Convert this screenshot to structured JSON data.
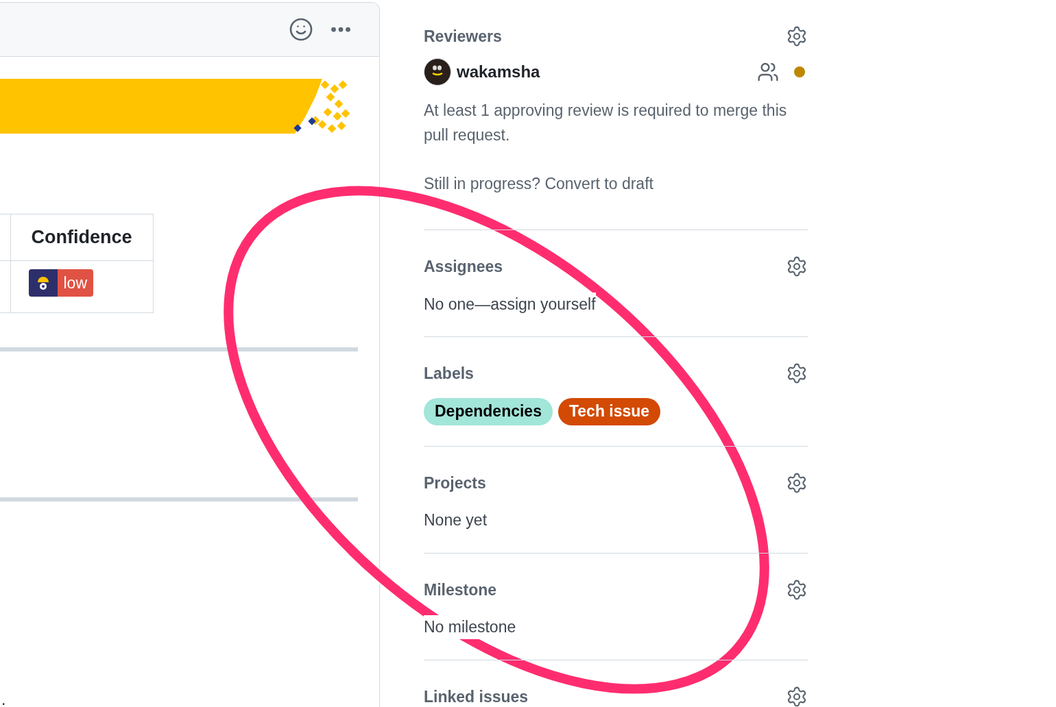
{
  "table": {
    "columns": [
      "Confidence"
    ],
    "rows": [
      {
        "confidence": "low"
      }
    ]
  },
  "fragment": ".",
  "sidebar": {
    "reviewers": {
      "heading": "Reviewers",
      "reviewer": {
        "name": "wakamsha",
        "color": "#bf8700"
      },
      "note": "At least 1 approving review is required to merge this pull request.",
      "prompt": "Still in progress?",
      "link": "Convert to draft"
    },
    "sections": [
      {
        "kind": "text",
        "heading": "Assignees",
        "text": "No one—assign yourself"
      },
      {
        "kind": "labels",
        "heading": "Labels",
        "labels": [
          {
            "name": "Dependencies",
            "color": "#a2e5d9"
          },
          {
            "name": "Tech issue",
            "color": "#d34a04"
          }
        ]
      },
      {
        "kind": "text",
        "heading": "Projects",
        "text": "None yet"
      },
      {
        "kind": "text",
        "heading": "Milestone",
        "text": "No milestone"
      },
      {
        "kind": "heading",
        "heading": "Linked issues"
      }
    ]
  }
}
